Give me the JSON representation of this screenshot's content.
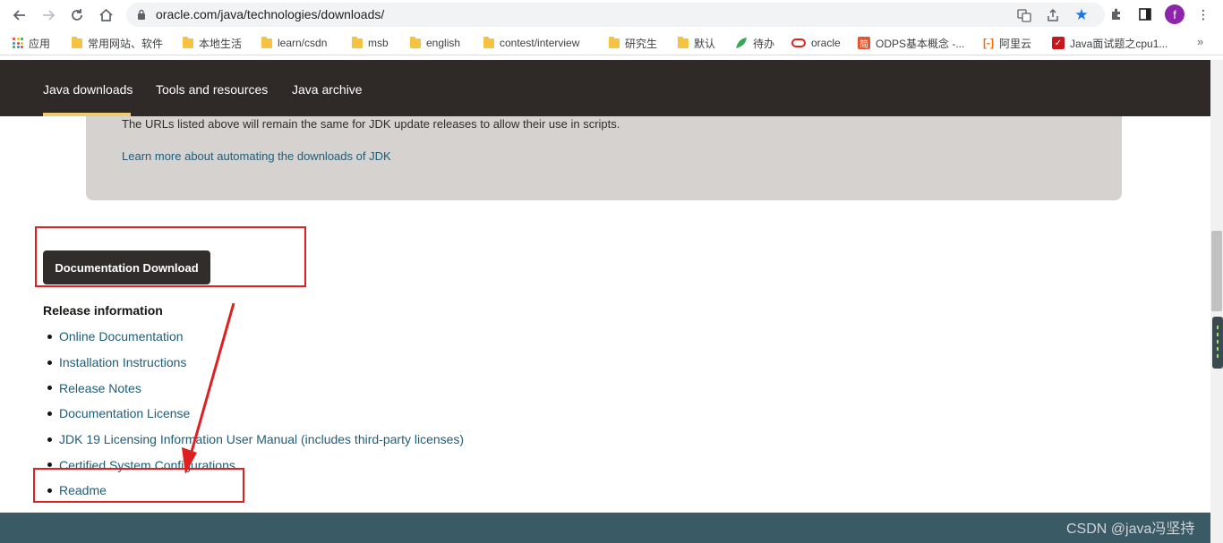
{
  "browser": {
    "url": "oracle.com/java/technologies/downloads/",
    "avatar_letter": "f",
    "bookmarks": [
      {
        "label": "应用",
        "icon": "apps-grid-icon"
      },
      {
        "label": "常用网站、软件",
        "icon": "folder-icon"
      },
      {
        "label": "本地生活",
        "icon": "folder-icon"
      },
      {
        "label": "learn/csdn",
        "icon": "folder-icon"
      },
      {
        "label": "msb",
        "icon": "folder-icon"
      },
      {
        "label": "english",
        "icon": "folder-icon"
      },
      {
        "label": "contest/interview",
        "icon": "folder-icon"
      },
      {
        "label": "研究生",
        "icon": "folder-icon"
      },
      {
        "label": "默认",
        "icon": "folder-icon"
      },
      {
        "label": "待办",
        "icon": "todo-leaf-icon"
      },
      {
        "label": "oracle",
        "icon": "oracle-logo-icon"
      },
      {
        "label": "ODPS基本概念 -...",
        "icon": "jian-logo-icon"
      },
      {
        "label": "阿里云",
        "icon": "aliyun-logo-icon"
      },
      {
        "label": "Java面试题之cpu1...",
        "icon": "bookmark-red-icon"
      }
    ],
    "bookmarks_more": "»"
  },
  "oracle_nav": {
    "tabs": [
      "Java downloads",
      "Tools and resources",
      "Java archive"
    ],
    "active_tab": "Java downloads"
  },
  "info_box": {
    "text": "The URLs listed above will remain the same for JDK update releases to allow their use in scripts.",
    "link": "Learn more about automating the downloads of JDK"
  },
  "doc_download_button": "Documentation Download",
  "release": {
    "title": "Release information",
    "items": [
      "Online Documentation",
      "Installation Instructions",
      "Release Notes",
      "Documentation License",
      "JDK 19 Licensing Information User Manual (includes third-party licenses)",
      "Certified System Configurations",
      "Readme"
    ]
  },
  "watermark": "CSDN @java冯坚持",
  "colors": {
    "nav_bg": "#2f2a27",
    "active_tab_bar": "#f0cc71",
    "info_box_bg": "#d6d2cf",
    "link": "#1f5c78",
    "button_bg": "#312d2a",
    "footer_bg": "#3a5a66",
    "annotation": "#e02020"
  }
}
